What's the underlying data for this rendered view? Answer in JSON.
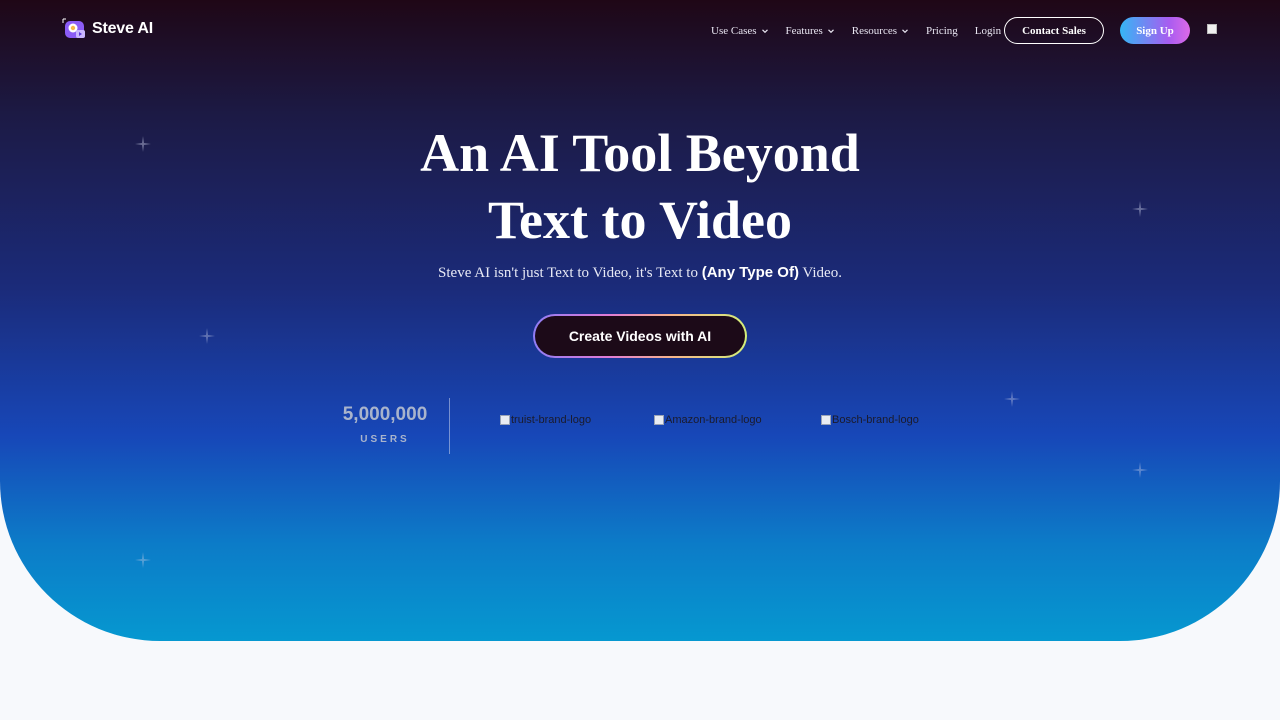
{
  "brand": {
    "name": "Steve AI"
  },
  "nav": {
    "items": [
      {
        "label": "Use Cases",
        "has_dropdown": true
      },
      {
        "label": "Features",
        "has_dropdown": true
      },
      {
        "label": "Resources",
        "has_dropdown": true
      },
      {
        "label": "Pricing",
        "has_dropdown": false
      },
      {
        "label": "Login",
        "has_dropdown": false
      }
    ],
    "contact_label": "Contact Sales",
    "signup_label": "Sign Up"
  },
  "hero": {
    "headline_line1": "An AI Tool Beyond",
    "headline_line2": "Text to Video",
    "sub_before": "Steve AI isn't just Text to Video, it's Text to ",
    "sub_bold": "(Any Type Of)",
    "sub_after": " Video.",
    "cta_label": "Create Videos with AI"
  },
  "stats": {
    "value": "5,000,000",
    "label": "USERS"
  },
  "logos": [
    {
      "alt": "truist-brand-logo"
    },
    {
      "alt": "Amazon-brand-logo"
    },
    {
      "alt": "Bosch-brand-logo"
    }
  ],
  "colors": {
    "hero_top": "#1f0716",
    "hero_mid": "#1b2b7a",
    "hero_bottom": "#0698d0",
    "page_bg": "#f7f9fc",
    "cta_bg": "#1c0a18",
    "signup_gradient_start": "#35b6f5",
    "signup_gradient_end": "#dc6ae8"
  }
}
